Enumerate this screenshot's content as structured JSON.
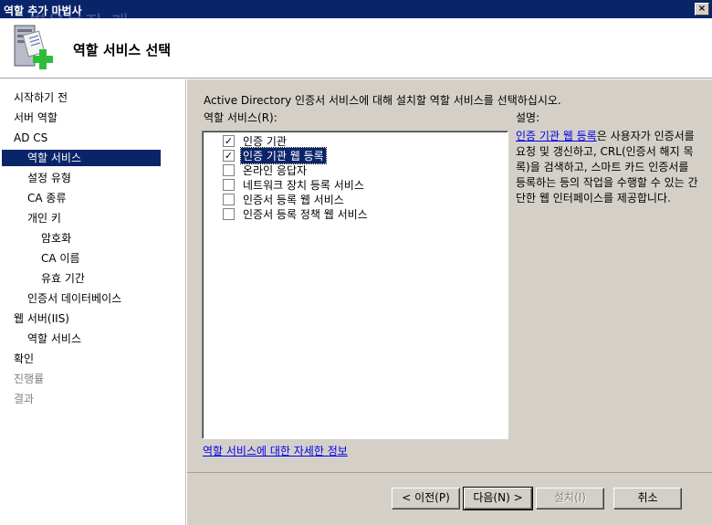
{
  "window": {
    "title": "역할 추가 마법사",
    "close_label": "×"
  },
  "watermark": "별을보지 개",
  "header": {
    "title": "역할 서비스 선택",
    "icon": "server-add-icon"
  },
  "nav": {
    "items": [
      {
        "label": "시작하기 전",
        "indent": 0,
        "state": "normal"
      },
      {
        "label": "서버 역할",
        "indent": 0,
        "state": "normal"
      },
      {
        "label": "AD CS",
        "indent": 0,
        "state": "normal"
      },
      {
        "label": "역할 서비스",
        "indent": 1,
        "state": "active"
      },
      {
        "label": "설정 유형",
        "indent": 1,
        "state": "normal"
      },
      {
        "label": "CA 종류",
        "indent": 1,
        "state": "normal"
      },
      {
        "label": "개인 키",
        "indent": 1,
        "state": "normal"
      },
      {
        "label": "암호화",
        "indent": 2,
        "state": "normal"
      },
      {
        "label": "CA 이름",
        "indent": 2,
        "state": "normal"
      },
      {
        "label": "유효 기간",
        "indent": 2,
        "state": "normal"
      },
      {
        "label": "인증서 데이터베이스",
        "indent": 1,
        "state": "normal"
      },
      {
        "label": "웹 서버(IIS)",
        "indent": 0,
        "state": "normal"
      },
      {
        "label": "역할 서비스",
        "indent": 1,
        "state": "normal"
      },
      {
        "label": "확인",
        "indent": 0,
        "state": "normal"
      },
      {
        "label": "진행률",
        "indent": 0,
        "state": "disabled"
      },
      {
        "label": "결과",
        "indent": 0,
        "state": "disabled"
      }
    ]
  },
  "main": {
    "instruction": "Active Directory 인증서 서비스에 대해 설치할 역할 서비스를 선택하십시오.",
    "roles_label": "역할 서비스(R):",
    "description_label": "설명:",
    "services": [
      {
        "label": "인증 기관",
        "checked": true,
        "selected": false
      },
      {
        "label": "인증 기관 웹 등록",
        "checked": true,
        "selected": true
      },
      {
        "label": "온라인 응답자",
        "checked": false,
        "selected": false
      },
      {
        "label": "네트워크 장치 등록 서비스",
        "checked": false,
        "selected": false
      },
      {
        "label": "인증서 등록 웹 서비스",
        "checked": false,
        "selected": false
      },
      {
        "label": "인증서 등록 정책 웹 서비스",
        "checked": false,
        "selected": false
      }
    ],
    "description_link": "인증 기관 웹 등록",
    "description_text": "은 사용자가 인증서를 요청 및 갱신하고, CRL(인증서 해지 목록)을 검색하고, 스마트 카드 인증서를 등록하는 등의 작업을 수행할 수 있는 간단한 웹 인터페이스를 제공합니다.",
    "more_info_link": "역할 서비스에 대한 자세한 정보"
  },
  "buttons": {
    "previous": "< 이전(P)",
    "next": "다음(N) >",
    "install": "설치(I)",
    "cancel": "취소"
  },
  "check_mark": "✓"
}
